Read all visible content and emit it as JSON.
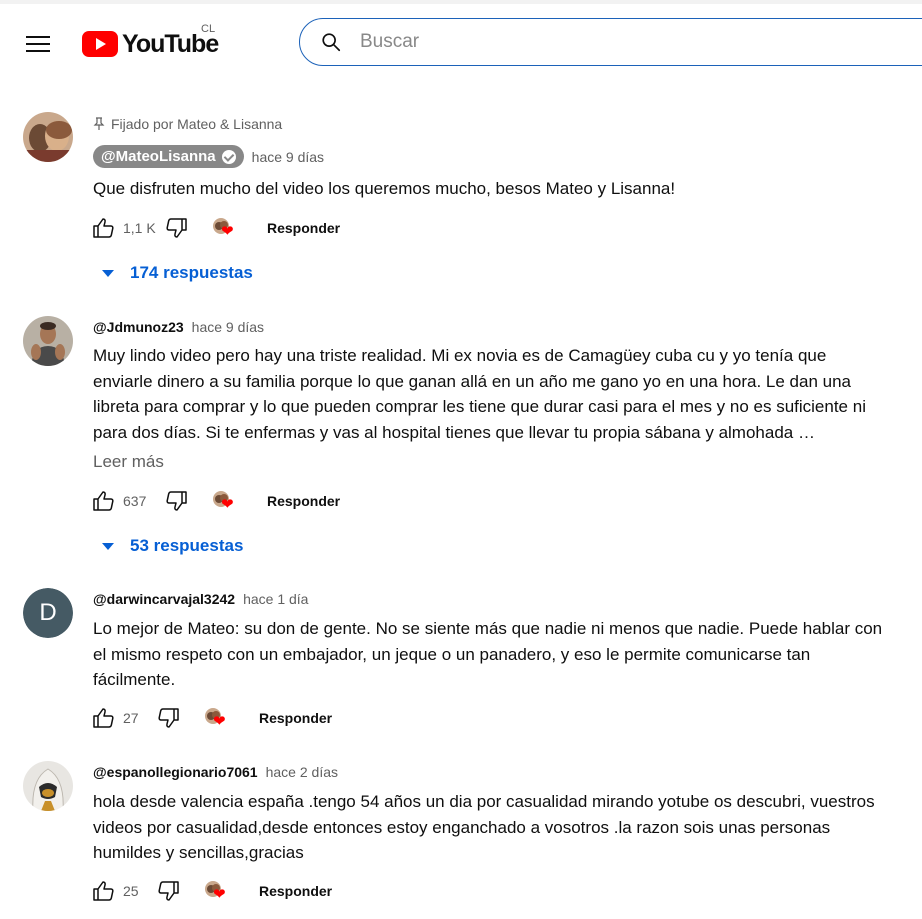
{
  "header": {
    "logo_text": "YouTube",
    "country_code": "CL",
    "search_placeholder": "Buscar"
  },
  "comments": [
    {
      "pinned_label": "Fijado por Mateo & Lisanna",
      "author": "@MateoLisanna",
      "verified": true,
      "time": "hace 9 días",
      "text": "Que disfruten mucho del video los queremos mucho, besos Mateo y Lisanna!",
      "likes": "1,1 K",
      "reply_label": "Responder",
      "replies_label": "174 respuestas"
    },
    {
      "author": "@Jdmunoz23",
      "time": "hace 9 días",
      "text": "Muy lindo video pero hay una triste realidad. Mi ex novia es de Camagüey cuba cu y yo tenía que enviarle dinero a su familia porque lo que ganan allá en un año me gano yo en una hora. Le dan una libreta para comprar y lo que pueden comprar les tiene que durar casi para el mes y no es suficiente ni para dos días. Si te enfermas y vas al hospital tienes que llevar tu propia sábana y almohada …",
      "read_more": "Leer más",
      "likes": "637",
      "reply_label": "Responder",
      "replies_label": "53 respuestas"
    },
    {
      "author": "@darwincarvajal3242",
      "avatar_letter": "D",
      "time": "hace 1 día",
      "text": "Lo mejor de Mateo: su don de gente. No se siente más que nadie ni menos que nadie. Puede hablar con el mismo respeto con un embajador, un jeque o un panadero, y eso le permite comunicarse tan fácilmente.",
      "likes": "27",
      "reply_label": "Responder"
    },
    {
      "author": "@espanollegionario7061",
      "time": "hace 2 días",
      "text": "hola desde valencia españa .tengo 54 años un dia por casualidad mirando yotube os descubri, vuestros videos por casualidad,desde entonces estoy enganchado a vosotros .la razon sois unas personas humildes y sencillas,gracias",
      "likes": "25",
      "reply_label": "Responder"
    }
  ],
  "colors": {
    "brand_red": "#ff0000",
    "link_blue": "#065fd4",
    "muted": "#606060"
  }
}
